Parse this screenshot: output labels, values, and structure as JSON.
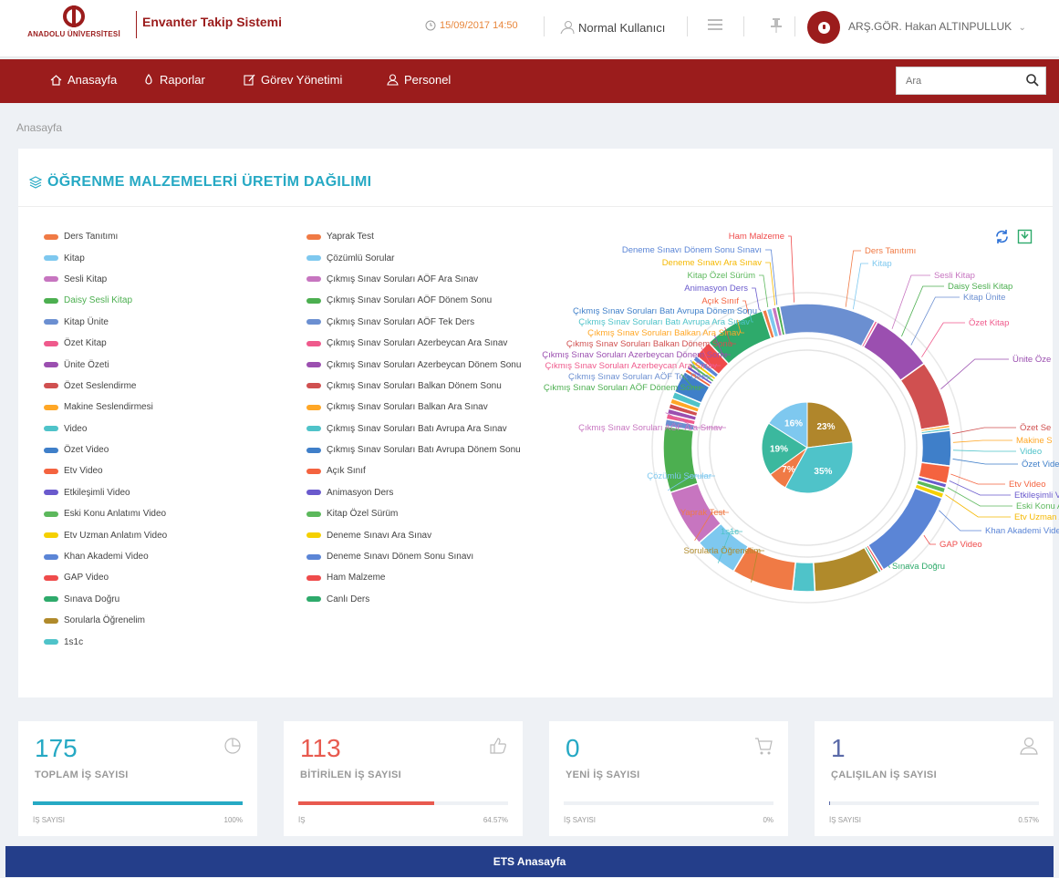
{
  "header": {
    "logo_text": "ANADOLU ÜNİVERSİTESİ",
    "app_title": "Envanter Takip Sistemi",
    "datetime": "15/09/2017 14:50",
    "user_role": "Normal Kullanıcı",
    "user_name": "ARŞ.GÖR. Hakan ALTINPULLUK"
  },
  "nav": {
    "items": [
      {
        "label": "Anasayfa",
        "icon": "home-icon"
      },
      {
        "label": "Raporlar",
        "icon": "fire-icon"
      },
      {
        "label": "Görev Yönetimi",
        "icon": "edit-icon"
      },
      {
        "label": "Personel",
        "icon": "user-icon"
      }
    ],
    "search_placeholder": "Ara"
  },
  "breadcrumb": "Anasayfa",
  "panel": {
    "title": "ÖĞRENME MALZEMELERİ ÜRETİM DAĞILIMI"
  },
  "legend": {
    "col1": [
      {
        "label": "Ders Tanıtımı",
        "color": "#f07a45"
      },
      {
        "label": "Kitap",
        "color": "#7ec8ef"
      },
      {
        "label": "Sesli Kitap",
        "color": "#c775c0"
      },
      {
        "label": "Daisy Sesli Kitap",
        "color": "#4caf50"
      },
      {
        "label": "Kitap Ünite",
        "color": "#6b8fd1"
      },
      {
        "label": "Özet Kitap",
        "color": "#ef5a8c"
      },
      {
        "label": "Ünite Özeti",
        "color": "#9b4fb0"
      },
      {
        "label": "Özet Seslendirme",
        "color": "#d05050"
      },
      {
        "label": "Makine Seslendirmesi",
        "color": "#ffa726"
      },
      {
        "label": "Video",
        "color": "#4fc3c9"
      },
      {
        "label": "Özet Video",
        "color": "#3f7fc9"
      },
      {
        "label": "Etv Video",
        "color": "#f4633f"
      },
      {
        "label": "Etkileşimli Video",
        "color": "#6a5acd"
      },
      {
        "label": "Eski Konu Anlatımı Video",
        "color": "#5cb85c"
      },
      {
        "label": "Etv Uzman Anlatım Video",
        "color": "#f5d000"
      },
      {
        "label": "Khan Akademi Video",
        "color": "#5b85d6"
      },
      {
        "label": "GAP Video",
        "color": "#ef4b4b"
      },
      {
        "label": "Sınava Doğru",
        "color": "#2eaa6b"
      },
      {
        "label": "Sorularla Öğrenelim",
        "color": "#b08a2b"
      },
      {
        "label": "1s1c",
        "color": "#4fc3c9"
      }
    ],
    "col2": [
      {
        "label": "Yaprak Test",
        "color": "#f07a45"
      },
      {
        "label": "Çözümlü Sorular",
        "color": "#7ec8ef"
      },
      {
        "label": "Çıkmış Sınav Soruları AÖF Ara Sınav",
        "color": "#c775c0"
      },
      {
        "label": "Çıkmış Sınav Soruları AÖF Dönem Sonu",
        "color": "#4caf50"
      },
      {
        "label": "Çıkmış Sınav Soruları AÖF Tek Ders",
        "color": "#6b8fd1"
      },
      {
        "label": "Çıkmış Sınav Soruları Azerbeycan Ara Sınav",
        "color": "#ef5a8c"
      },
      {
        "label": "Çıkmış Sınav Soruları Azerbeycan Dönem Sonu",
        "color": "#9b4fb0"
      },
      {
        "label": "Çıkmış Sınav Soruları Balkan Dönem Sonu",
        "color": "#d05050"
      },
      {
        "label": "Çıkmış Sınav Soruları Balkan Ara Sınav",
        "color": "#ffa726"
      },
      {
        "label": "Çıkmış Sınav Soruları Batı Avrupa Ara Sınav",
        "color": "#4fc3c9"
      },
      {
        "label": "Çıkmış Sınav Soruları Batı Avrupa Dönem Sonu",
        "color": "#3f7fc9"
      },
      {
        "label": "Açık Sınıf",
        "color": "#f4633f"
      },
      {
        "label": "Animasyon Ders",
        "color": "#6a5acd"
      },
      {
        "label": "Kitap Özel Sürüm",
        "color": "#5cb85c"
      },
      {
        "label": "Deneme Sınavı Ara Sınav",
        "color": "#f5d000"
      },
      {
        "label": "Deneme Sınavı Dönem Sonu Sınavı",
        "color": "#5b85d6"
      },
      {
        "label": "Ham Malzeme",
        "color": "#ef4b4b"
      },
      {
        "label": "Canlı Ders",
        "color": "#2eaa6b"
      }
    ]
  },
  "chart_data": {
    "type": "pie",
    "outer_ring": [
      {
        "label": "Canlı Ders",
        "value": 7.0,
        "color": "#2eaa6b"
      },
      {
        "label": "Ders Tanıtımı",
        "value": 0.5,
        "color": "#f07a45"
      },
      {
        "label": "Kitap",
        "value": 0.6,
        "color": "#7ec8ef"
      },
      {
        "label": "Sesli Kitap",
        "value": 0.5,
        "color": "#c775c0"
      },
      {
        "label": "Daisy Sesli Kitap",
        "value": 0.4,
        "color": "#4caf50"
      },
      {
        "label": "Kitap Ünite",
        "value": 11.0,
        "color": "#6b8fd1"
      },
      {
        "label": "Özet Kitap",
        "value": 0.3,
        "color": "#ef5a8c"
      },
      {
        "label": "Ünite Özeti",
        "value": 7.0,
        "color": "#9b4fb0"
      },
      {
        "label": "Özet Seslendirme",
        "value": 7.5,
        "color": "#d05050"
      },
      {
        "label": "Makine Seslendirmesi",
        "value": 0.3,
        "color": "#ffa726"
      },
      {
        "label": "Video",
        "value": 0.3,
        "color": "#4fc3c9"
      },
      {
        "label": "Özet Video",
        "value": 4.0,
        "color": "#3f7fc9"
      },
      {
        "label": "Etv Video",
        "value": 2.0,
        "color": "#f4633f"
      },
      {
        "label": "Etkileşimli Video",
        "value": 0.5,
        "color": "#6a5acd"
      },
      {
        "label": "Eski Konu Anlatımı Video",
        "value": 0.6,
        "color": "#5cb85c"
      },
      {
        "label": "Etv Uzman Anlatım Video",
        "value": 0.6,
        "color": "#f5d000"
      },
      {
        "label": "Khan Akademi Video",
        "value": 10.5,
        "color": "#5b85d6"
      },
      {
        "label": "GAP Video",
        "value": 0.3,
        "color": "#ef4b4b"
      },
      {
        "label": "Sınava Doğru",
        "value": 0.3,
        "color": "#2eaa6b"
      },
      {
        "label": "Sorularla Öğrenelim",
        "value": 7.5,
        "color": "#b08a2b"
      },
      {
        "label": "1s1c",
        "value": 2.5,
        "color": "#4fc3c9"
      },
      {
        "label": "Yaprak Test",
        "value": 7.0,
        "color": "#f07a45"
      },
      {
        "label": "Çözümlü Sorular",
        "value": 5.0,
        "color": "#7ec8ef"
      },
      {
        "label": "Çıkmış Sınav Soruları AÖF Ara Sınav",
        "value": 6.5,
        "color": "#c775c0"
      },
      {
        "label": "Çıkmış Sınav Soruları AÖF Dönem Sonu",
        "value": 7.5,
        "color": "#4caf50"
      },
      {
        "label": "Çıkmış Sınav Soruları AÖF Tek Ders",
        "value": 0.8,
        "color": "#6b8fd1"
      },
      {
        "label": "Çıkmış Sınav Soruları Azerbeycan Ara Sınav",
        "value": 0.6,
        "color": "#ef5a8c"
      },
      {
        "label": "Çıkmış Sınav Soruları Azerbeycan Dönem Sonu",
        "value": 0.6,
        "color": "#9b4fb0"
      },
      {
        "label": "Çıkmış Sınav Soruları Balkan Dönem Sonu",
        "value": 0.6,
        "color": "#d05050"
      },
      {
        "label": "Çıkmış Sınav Soruları Balkan Ara Sınav",
        "value": 0.6,
        "color": "#ffa726"
      },
      {
        "label": "Çıkmış Sınav Soruları Batı Avrupa Ara Sınav",
        "value": 0.8,
        "color": "#4fc3c9"
      },
      {
        "label": "Çıkmış Sınav Soruları Batı Avrupa Dönem Sonu",
        "value": 2.5,
        "color": "#3f7fc9"
      },
      {
        "label": "Açık Sınıf",
        "value": 0.4,
        "color": "#f4633f"
      },
      {
        "label": "Animasyon Ders",
        "value": 0.4,
        "color": "#6a5acd"
      },
      {
        "label": "Kitap Özel Sürüm",
        "value": 0.4,
        "color": "#5cb85c"
      },
      {
        "label": "Deneme Sınavı Ara Sınav",
        "value": 0.4,
        "color": "#f5d000"
      },
      {
        "label": "Deneme Sınavı Dönem Sonu Sınavı",
        "value": 0.6,
        "color": "#5b85d6"
      },
      {
        "label": "Ham Malzeme",
        "value": 2.0,
        "color": "#ef4b4b"
      }
    ],
    "outer_labels_visible": [
      {
        "text": "Ham Malzeme",
        "color": "#ef4b4b"
      },
      {
        "text": "Deneme Sınavı Dönem Sonu Sınavı",
        "color": "#5b85d6"
      },
      {
        "text": "Deneme Sınavı Ara Sınav",
        "color": "#f5b800"
      },
      {
        "text": "Kitap Özel Sürüm",
        "color": "#5cb85c"
      },
      {
        "text": "Animasyon Ders",
        "color": "#6a5acd"
      },
      {
        "text": "Açık Sınıf",
        "color": "#f4633f"
      },
      {
        "text": "Çıkmış Sınav Soruları Batı Avrupa Dönem Sonu",
        "color": "#3f7fc9"
      },
      {
        "text": "Çıkmış Sınav Soruları Batı Avrupa Ara Sınav",
        "color": "#4fc3c9"
      },
      {
        "text": "Çıkmış Sınav Soruları Balkan Ara Sınav",
        "color": "#ffa726"
      },
      {
        "text": "Çıkmış Sınav Soruları Balkan Dönem Sonu",
        "color": "#d05050"
      },
      {
        "text": "Çıkmış Sınav Soruları Azerbeycan Dönem Sonu",
        "color": "#9b4fb0"
      },
      {
        "text": "Çıkmış Sınav Soruları Azerbeycan Ara Sınav",
        "color": "#ef5a8c"
      },
      {
        "text": "Çıkmış Sınav Soruları AÖF Tek Ders",
        "color": "#6b8fd1"
      },
      {
        "text": "Çıkmış Sınav Soruları AÖF Dönem Sonu",
        "color": "#4caf50"
      },
      {
        "text": "Çıkmış Sınav Soruları AÖF Ara Sınav",
        "color": "#c775c0"
      },
      {
        "text": "Çözümlü Sorular",
        "color": "#7ec8ef"
      },
      {
        "text": "Yaprak Test",
        "color": "#f07a45"
      },
      {
        "text": "1s1c",
        "color": "#4fc3c9"
      },
      {
        "text": "Sorularla Öğrenelim",
        "color": "#b08a2b"
      },
      {
        "text": "Sınava Doğru",
        "color": "#2eaa6b"
      },
      {
        "text": "GAP Video",
        "color": "#ef4b4b"
      },
      {
        "text": "Khan Akademi Video",
        "color": "#5b85d6"
      },
      {
        "text": "Etv Uzman Anlatı",
        "color": "#f5b800"
      },
      {
        "text": "Eski Konu Anla",
        "color": "#5cb85c"
      },
      {
        "text": "Etkileşimli Vid",
        "color": "#6a5acd"
      },
      {
        "text": "Etv Video",
        "color": "#f4633f"
      },
      {
        "text": "Özet Vide",
        "color": "#3f7fc9"
      },
      {
        "text": "Video",
        "color": "#4fc3c9"
      },
      {
        "text": "Makine S",
        "color": "#ffa726"
      },
      {
        "text": "Özet Se",
        "color": "#d05050"
      },
      {
        "text": "Ünite Öze",
        "color": "#9b4fb0"
      },
      {
        "text": "Özet Kitap",
        "color": "#ef5a8c"
      },
      {
        "text": "Kitap Ünite",
        "color": "#6b8fd1"
      },
      {
        "text": "Daisy Sesli Kitap",
        "color": "#4caf50"
      },
      {
        "text": "Sesli Kitap",
        "color": "#c775c0"
      },
      {
        "text": "Kitap",
        "color": "#7ec8ef"
      },
      {
        "text": "Ders Tanıtımı",
        "color": "#f07a45"
      }
    ],
    "inner_pie": [
      {
        "label": "23%",
        "value": 23,
        "color": "#b0862b"
      },
      {
        "label": "35%",
        "value": 35,
        "color": "#4fc3c9"
      },
      {
        "label": "7%",
        "value": 7,
        "color": "#f07a45"
      },
      {
        "label": "19%",
        "value": 19,
        "color": "#3bb89e"
      },
      {
        "label": "16%",
        "value": 16,
        "color": "#7ec8ef"
      }
    ]
  },
  "cards": [
    {
      "value": "175",
      "label": "TOPLAM İŞ SAYISI",
      "sub": "İŞ SAYISI",
      "pct_label": "100%",
      "pct": 100,
      "color": "#26a9c4",
      "icon": "pie-chart-icon"
    },
    {
      "value": "113",
      "label": "BİTİRİLEN İŞ SAYISI",
      "sub": "İŞ",
      "pct_label": "64.57%",
      "pct": 64.57,
      "color": "#e85a4f",
      "icon": "thumbs-up-icon"
    },
    {
      "value": "0",
      "label": "YENİ İŞ SAYISI",
      "sub": "İŞ SAYISI",
      "pct_label": "0%",
      "pct": 0,
      "color": "#26a9c4",
      "icon": "cart-icon"
    },
    {
      "value": "1",
      "label": "ÇALIŞILAN İŞ SAYISI",
      "sub": "İŞ SAYISI",
      "pct_label": "0.57%",
      "pct": 0.57,
      "color": "#5a6aa8",
      "icon": "user-icon"
    }
  ],
  "caption": "ETS Anasayfa"
}
